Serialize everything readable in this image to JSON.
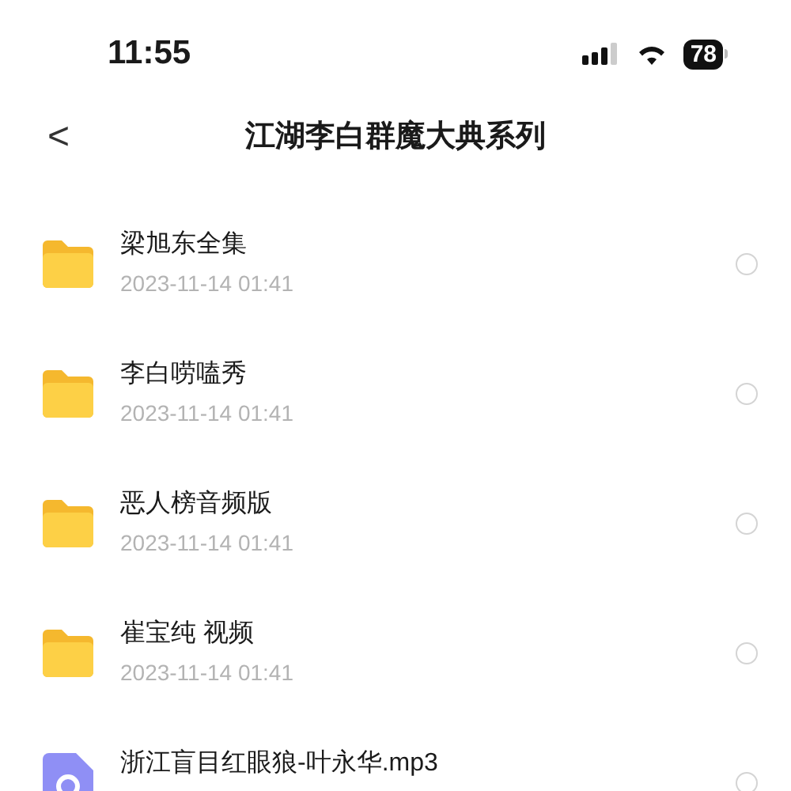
{
  "status_bar": {
    "time": "11:55",
    "battery": "78"
  },
  "header": {
    "back": "<",
    "title": "江湖李白群魔大典系列"
  },
  "items": [
    {
      "kind": "folder",
      "name": "梁旭东全集",
      "date": "2023-11-14 01:41",
      "selected": false
    },
    {
      "kind": "folder",
      "name": "李白唠嗑秀",
      "date": "2023-11-14 01:41",
      "selected": false
    },
    {
      "kind": "folder",
      "name": "恶人榜音频版",
      "date": "2023-11-14 01:41",
      "selected": false
    },
    {
      "kind": "folder",
      "name": "崔宝纯 视频",
      "date": "2023-11-14 01:41",
      "selected": false
    },
    {
      "kind": "audio",
      "name": "浙江盲目红眼狼-叶永华.mp3",
      "selected": false
    }
  ]
}
